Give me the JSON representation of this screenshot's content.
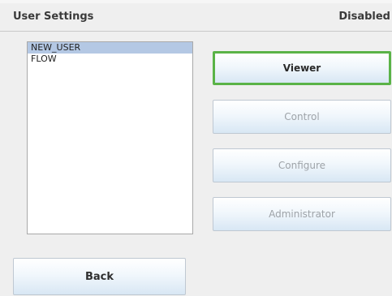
{
  "header": {
    "title": "User Settings",
    "status": "Disabled"
  },
  "user_list": {
    "items": [
      {
        "label": "NEW_USER",
        "selected": true
      },
      {
        "label": "FLOW",
        "selected": false
      }
    ]
  },
  "roles": {
    "viewer": "Viewer",
    "control": "Control",
    "configure": "Configure",
    "administrator": "Administrator",
    "active": "Viewer"
  },
  "footer": {
    "back_label": "Back"
  },
  "colors": {
    "active_border": "#5ab347",
    "selection": "#b4c8e4"
  }
}
